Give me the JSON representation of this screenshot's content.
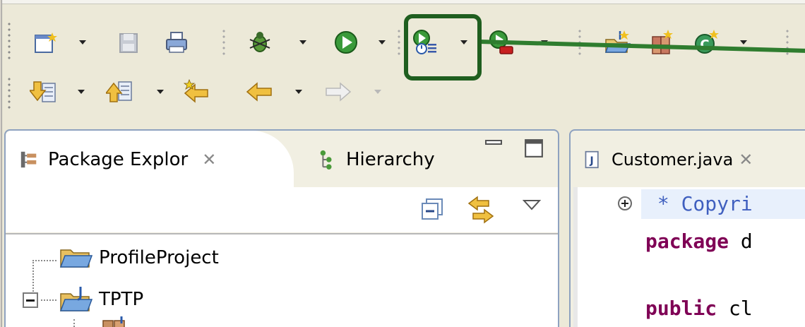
{
  "toolbar": {
    "row1": [
      {
        "name": "new-wizard-icon",
        "dropdown": true
      },
      {
        "name": "save-icon",
        "dropdown": false,
        "disabled": true
      },
      {
        "name": "print-icon",
        "dropdown": false
      },
      {
        "name": "debug-icon",
        "dropdown": true
      },
      {
        "name": "run-icon",
        "dropdown": true
      },
      {
        "name": "profile-icon",
        "dropdown": true,
        "highlighted": true
      },
      {
        "name": "external-tools-icon",
        "dropdown": true
      },
      {
        "name": "new-java-project-icon",
        "dropdown": false
      },
      {
        "name": "new-java-package-icon",
        "dropdown": false
      },
      {
        "name": "new-java-class-icon",
        "dropdown": true
      }
    ],
    "row2": [
      {
        "name": "next-annotation-icon",
        "dropdown": true
      },
      {
        "name": "previous-annotation-icon",
        "dropdown": true
      },
      {
        "name": "last-edit-location-icon",
        "dropdown": false
      },
      {
        "name": "back-icon",
        "dropdown": true
      },
      {
        "name": "forward-icon",
        "dropdown": true,
        "disabled": true
      }
    ],
    "highlight_color": "#1f5e1f",
    "annotation_line_color": "#2f7d2f"
  },
  "left_panel": {
    "tabs": [
      {
        "label": "Package Explor",
        "icon": "package-explorer-icon",
        "active": true
      },
      {
        "label": "Hierarchy",
        "icon": "hierarchy-icon",
        "active": false
      }
    ],
    "close_glyph": "✕",
    "tree": [
      {
        "label": "ProfileProject",
        "icon": "folder-icon",
        "expanded": false
      },
      {
        "label": "TPTP",
        "icon": "java-project-folder-icon",
        "expanded": true
      }
    ]
  },
  "editor": {
    "tab_label": "Customer.java",
    "lines": [
      {
        "kind": "comment",
        "text": " * Copyri"
      },
      {
        "kind": "code",
        "keyword": "package",
        "rest": " d"
      },
      {
        "kind": "blank",
        "text": ""
      },
      {
        "kind": "code",
        "keyword": "public",
        "rest": " cl"
      }
    ]
  },
  "colors": {
    "keyword": "#7f0055",
    "comment": "#3f5fbf",
    "panel_border": "#8ea2c0"
  }
}
